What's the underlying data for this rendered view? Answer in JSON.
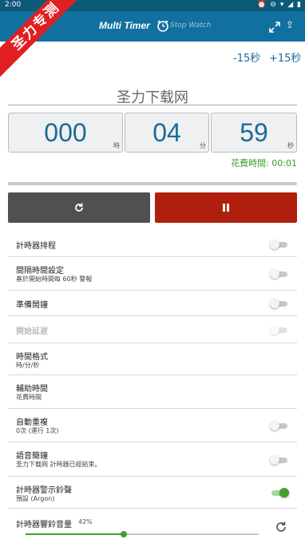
{
  "status": {
    "time": "2:00"
  },
  "app": {
    "title": "Multi Timer",
    "tab_stopwatch": "Stop Watch"
  },
  "watermark": "圣力专测",
  "adjust": {
    "minus": "-15秒",
    "plus": "+15秒"
  },
  "timer": {
    "name": "圣力下载网",
    "hours": "000",
    "hours_unit": "時",
    "minutes": "04",
    "minutes_unit": "分",
    "seconds": "59",
    "seconds_unit": "秒",
    "elapsed": "花費時間: 00:01",
    "progress": 0.003
  },
  "settings": [
    {
      "label": "計時器排程",
      "sub": "",
      "toggle": "off"
    },
    {
      "label": "間隔時間設定",
      "sub": "基於開始時間每 60秒 警報",
      "toggle": "off"
    },
    {
      "label": "準備鬧鐘",
      "sub": "",
      "toggle": "off"
    },
    {
      "label": "開始延遲",
      "sub": "",
      "toggle": "disabled"
    },
    {
      "label": "時間格式",
      "sub": "時/分/秒",
      "toggle": ""
    },
    {
      "label": "輔助時間",
      "sub": "花費時間",
      "toggle": ""
    },
    {
      "label": "自動重複",
      "sub": "0次 (運行 1次)",
      "toggle": "off"
    },
    {
      "label": "語音簡鐘",
      "sub": "圣力下载网 計時器已經結束。",
      "toggle": "off"
    },
    {
      "label": "計時器警示鈴聲",
      "sub": "預設 (Argon)",
      "toggle": "on"
    }
  ],
  "volume": {
    "label": "計時器響鈴音量",
    "percent": "42%",
    "value": 0.42
  },
  "colors": {
    "appbar": "#1170a0",
    "accent": "#1a6a98",
    "pause": "#b01e0e",
    "reset": "#505050",
    "green": "#3fa02c"
  }
}
